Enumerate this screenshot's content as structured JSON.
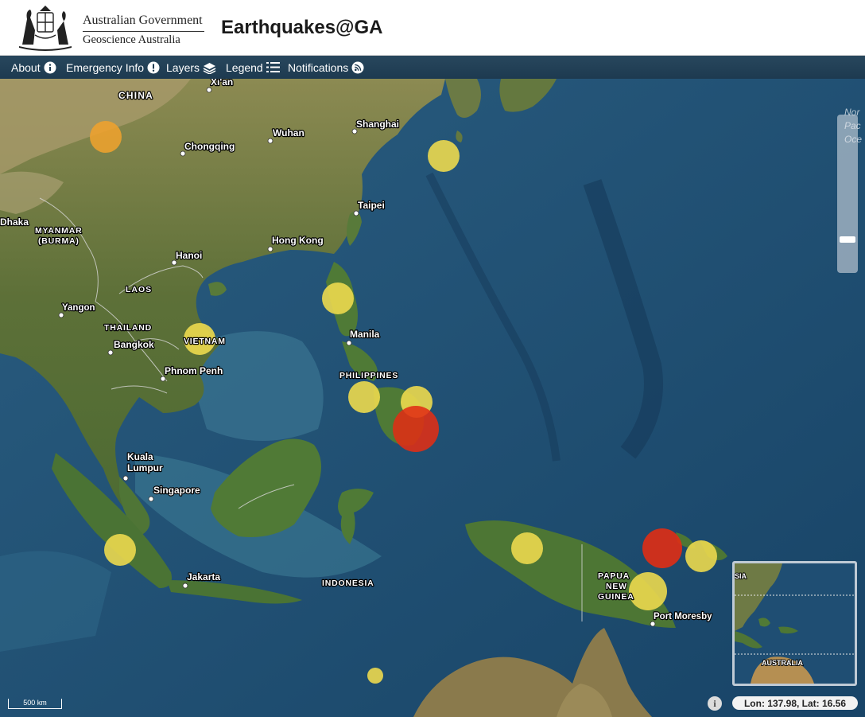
{
  "header": {
    "government": "Australian Government",
    "agency": "Geoscience Australia",
    "app_title": "Earthquakes@GA",
    "crest_icon": "coat-of-arms-icon"
  },
  "nav": {
    "items": [
      {
        "label": "About",
        "icon": "info-circle-icon"
      },
      {
        "label": "Emergency Info",
        "icon": "exclamation-circle-icon"
      },
      {
        "label": "Layers",
        "icon": "layers-icon"
      },
      {
        "label": "Legend",
        "icon": "list-icon"
      },
      {
        "label": "Notifications",
        "icon": "rss-icon"
      }
    ]
  },
  "map": {
    "ocean_label_fragment": "Nor\nPac\nOce",
    "places": {
      "xian": "Xi'an",
      "china": "CHINA",
      "wuhan": "Wuhan",
      "shanghai": "Shanghai",
      "chongqing": "Chongqing",
      "dhaka": "Dhaka",
      "myanmar": "MYANMAR",
      "burma": "(BURMA)",
      "taipei": "Taipei",
      "hongkong": "Hong Kong",
      "hanoi": "Hanoi",
      "laos": "LAOS",
      "yangon": "Yangon",
      "thailand": "THAILAND",
      "bangkok": "Bangkok",
      "vietnam": "VIETNAM",
      "manila": "Manila",
      "phnompenh": "Phnom Penh",
      "philippines": "PHILIPPINES",
      "kuala": "Kuala",
      "lumpur": "Lumpur",
      "singapore": "Singapore",
      "jakarta": "Jakarta",
      "indonesia": "INDONESIA",
      "papua": "PAPUA",
      "new": "NEW",
      "guinea": "GUINEA",
      "portmoresby": "Port Moresby"
    },
    "overview": {
      "label": "AUSTRALIA",
      "edge_label": "SIA"
    },
    "zoom_level": 0.82,
    "scale_label": "500 km",
    "coordinates": "Lon: 137.98, Lat: 16.56",
    "info_glyph": "i",
    "colors": {
      "quake_yellow": "#ecd94e",
      "quake_orange": "#eea22d",
      "quake_red": "#e02e14"
    }
  }
}
